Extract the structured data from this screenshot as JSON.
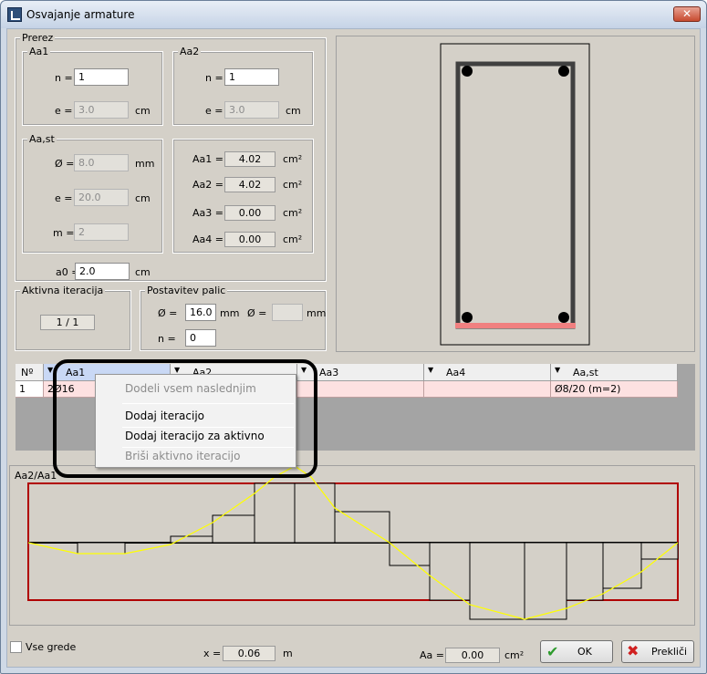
{
  "window": {
    "title": "Osvajanje armature",
    "close_label": "✕"
  },
  "prerez": {
    "label": "Prerez",
    "aa1": {
      "label": "Aa1",
      "n_label": "n =",
      "n_value": "1",
      "e_label": "e =",
      "e_value": "3.0",
      "e_unit": "cm"
    },
    "aa2": {
      "label": "Aa2",
      "n_label": "n =",
      "n_value": "1",
      "e_label": "e =",
      "e_value": "3.0",
      "e_unit": "cm"
    },
    "aast": {
      "label": "Aa,st",
      "d_label": "Ø =",
      "d_value": "8.0",
      "d_unit": "mm",
      "e_label": "e =",
      "e_value": "20.0",
      "e_unit": "cm",
      "m_label": "m =",
      "m_value": "2"
    },
    "areas": [
      {
        "label": "Aa1 =",
        "value": "4.02",
        "unit": "cm²"
      },
      {
        "label": "Aa2 =",
        "value": "4.02",
        "unit": "cm²"
      },
      {
        "label": "Aa3 =",
        "value": "0.00",
        "unit": "cm²"
      },
      {
        "label": "Aa4 =",
        "value": "0.00",
        "unit": "cm²"
      }
    ],
    "a0": {
      "label": "a0 =",
      "value": "2.0",
      "unit": "cm"
    }
  },
  "aktivna": {
    "label": "Aktivna iteracija",
    "value": "1 / 1"
  },
  "postavitev": {
    "label": "Postavitev palic",
    "d1_label": "Ø =",
    "d1_value": "16.0",
    "d1_unit": "mm",
    "d2_label": "Ø =",
    "d2_value": "",
    "d2_unit": "mm",
    "n_label": "n =",
    "n_value": "0"
  },
  "grid": {
    "columns": [
      "Nº",
      "Aa1",
      "Aa2",
      "Aa3",
      "Aa4",
      "Aa,st"
    ],
    "rows": [
      {
        "no": "1",
        "aa1": "2Ø16",
        "aa2": "",
        "aa3": "",
        "aa4": "",
        "aast": "Ø8/20 (m=2)"
      }
    ]
  },
  "context_menu": {
    "items": [
      {
        "label": "Dodeli vsem naslednjim",
        "enabled": false
      },
      {
        "label": "Dodaj iteracijo",
        "enabled": true
      },
      {
        "label": "Dodaj iteracijo za aktivno",
        "enabled": true
      },
      {
        "label": "Briši aktivno iteracijo",
        "enabled": false
      }
    ]
  },
  "diagram": {
    "label": "Aa2/Aa1"
  },
  "bottom": {
    "vse_grede_label": "Vse grede",
    "x_label": "x =",
    "x_value": "0.06",
    "x_unit": "m",
    "aa_label": "Aa =",
    "aa_value": "0.00",
    "aa_unit": "cm²",
    "ok_label": "OK",
    "cancel_label": "Prekliči"
  },
  "colors": {
    "accent": "#f08080",
    "diagram_red": "#b00000",
    "diagram_yellow": "#ffff00"
  }
}
